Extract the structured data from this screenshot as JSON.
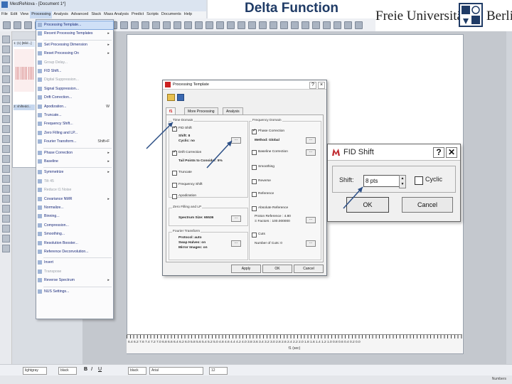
{
  "slide": {
    "title": "Delta Function"
  },
  "logo": {
    "text_left": "Freie Universität",
    "text_right": "Berlin"
  },
  "app": {
    "window_title": "MestReNova - [Document 1*]",
    "menubar": [
      "File",
      "Edit",
      "View",
      "Processing",
      "Analysis",
      "Advanced",
      "Stack",
      "Mass Analysis",
      "Predict",
      "Scripts",
      "Documents",
      "Help"
    ],
    "active_menu": "Processing",
    "doc_thumbs": [
      "1: (1) [Bild...]",
      "2: shiftedd..."
    ],
    "font_selects": [
      "lightgray",
      "black",
      "black",
      "Arial",
      "12"
    ],
    "status": "Numbers"
  },
  "processing_menu": {
    "items": [
      {
        "label": "Processing Template...",
        "highlight": true
      },
      {
        "label": "Recent Processing Templates",
        "submenu": true
      },
      {
        "sep": true
      },
      {
        "label": "Set Processing Dimension",
        "submenu": true
      },
      {
        "label": "Reset Processing On",
        "submenu": true
      },
      {
        "label": "Group Delay...",
        "disabled": true
      },
      {
        "label": "FID Shift..."
      },
      {
        "label": "Digital Suppression...",
        "disabled": true
      },
      {
        "label": "Signal Suppression..."
      },
      {
        "label": "Drift Correction..."
      },
      {
        "label": "Apodization...",
        "shortcut": "W"
      },
      {
        "label": "Truncate..."
      },
      {
        "label": "Frequency Shift..."
      },
      {
        "label": "Zero Filling and LP..."
      },
      {
        "label": "Fourier Transform...",
        "shortcut": "Shift+F"
      },
      {
        "sep": true
      },
      {
        "label": "Phase Correction",
        "submenu": true
      },
      {
        "label": "Baseline",
        "submenu": true
      },
      {
        "sep": true
      },
      {
        "label": "Symmetrize",
        "submenu": true
      },
      {
        "label": "Tilt 45",
        "disabled": true
      },
      {
        "label": "Reduce t1 Noise",
        "disabled": true
      },
      {
        "label": "Covariance NMR",
        "submenu": true
      },
      {
        "label": "Normalize..."
      },
      {
        "label": "Binning..."
      },
      {
        "label": "Compression..."
      },
      {
        "label": "Smoothing..."
      },
      {
        "label": "Resolution Booster..."
      },
      {
        "label": "Reference Deconvolution..."
      },
      {
        "sep": true
      },
      {
        "label": "Invert"
      },
      {
        "label": "Transpose",
        "disabled": true
      },
      {
        "label": "Reverse Spectrum",
        "submenu": true
      },
      {
        "sep": true
      },
      {
        "label": "NUS Settings..."
      }
    ]
  },
  "processing_template": {
    "title": "Processing Template",
    "tabs": [
      "f1",
      "More Processing",
      "Analysis"
    ],
    "time_domain": {
      "label": "Time Domain",
      "fid_shift": {
        "label": "FID Shift",
        "checked": true,
        "shift": "Shift: 8",
        "cyclic": "Cyclic: no"
      },
      "drift": {
        "label": "Drift Correction",
        "checked": true,
        "points": "Tail Points to Consider: 5%"
      },
      "truncate": "Truncate",
      "freq_shift": "Frequency Shift",
      "apodization": "Apodization"
    },
    "zero_filling": {
      "label": "Zero Filling and LP",
      "size": "Spectrum Size: 65536"
    },
    "fourier": {
      "label": "Fourier Transform",
      "protocol": "Protocol: auto",
      "swap": "Swap Halves: on",
      "mirror": "Mirror Images: on"
    },
    "freq_domain": {
      "label": "Frequency Domain",
      "phase": {
        "label": "Phase Correction",
        "checked": true,
        "method": "Method: Global"
      },
      "baseline": "Baseline Correction",
      "smoothing": "Smoothing",
      "reverse": "Reverse",
      "reference": "Reference",
      "absolute_ref": "Absolute Reference",
      "proton": "Proton Reference : 4.80",
      "xi": "Ξ Factors : 100.000000",
      "cuts": "Cuts",
      "num_cuts": "Number of Cuts: 0"
    },
    "buttons": [
      "Apply",
      "OK",
      "Cancel"
    ]
  },
  "fid_shift_dialog": {
    "title": "FID Shift",
    "shift_label": "Shift:",
    "shift_value": "8 pts",
    "cyclic_label": "Cyclic",
    "ok": "OK",
    "cancel": "Cancel"
  },
  "axis": {
    "ticks": "6.4 6.2 7.6 7.4 7.2 7.0 6.8 6.6 6.4 6.2 6.0 5.8 5.6 5.4 5.2 5.0 4.8 4.6 4.4 4.2 4.0 3.8 3.6 3.4 3.2 3.0 2.8 2.6 2.4 2.2 2.0 1.8 1.6 1.4 1.2 1.0 0.8 0.6 0.4 0.2 0.0",
    "label": "f1 (sec)"
  },
  "colors": {
    "title_blue": "#1f3b66",
    "menu_text": "#1a2a7a",
    "highlight": "#cfe0f7"
  }
}
